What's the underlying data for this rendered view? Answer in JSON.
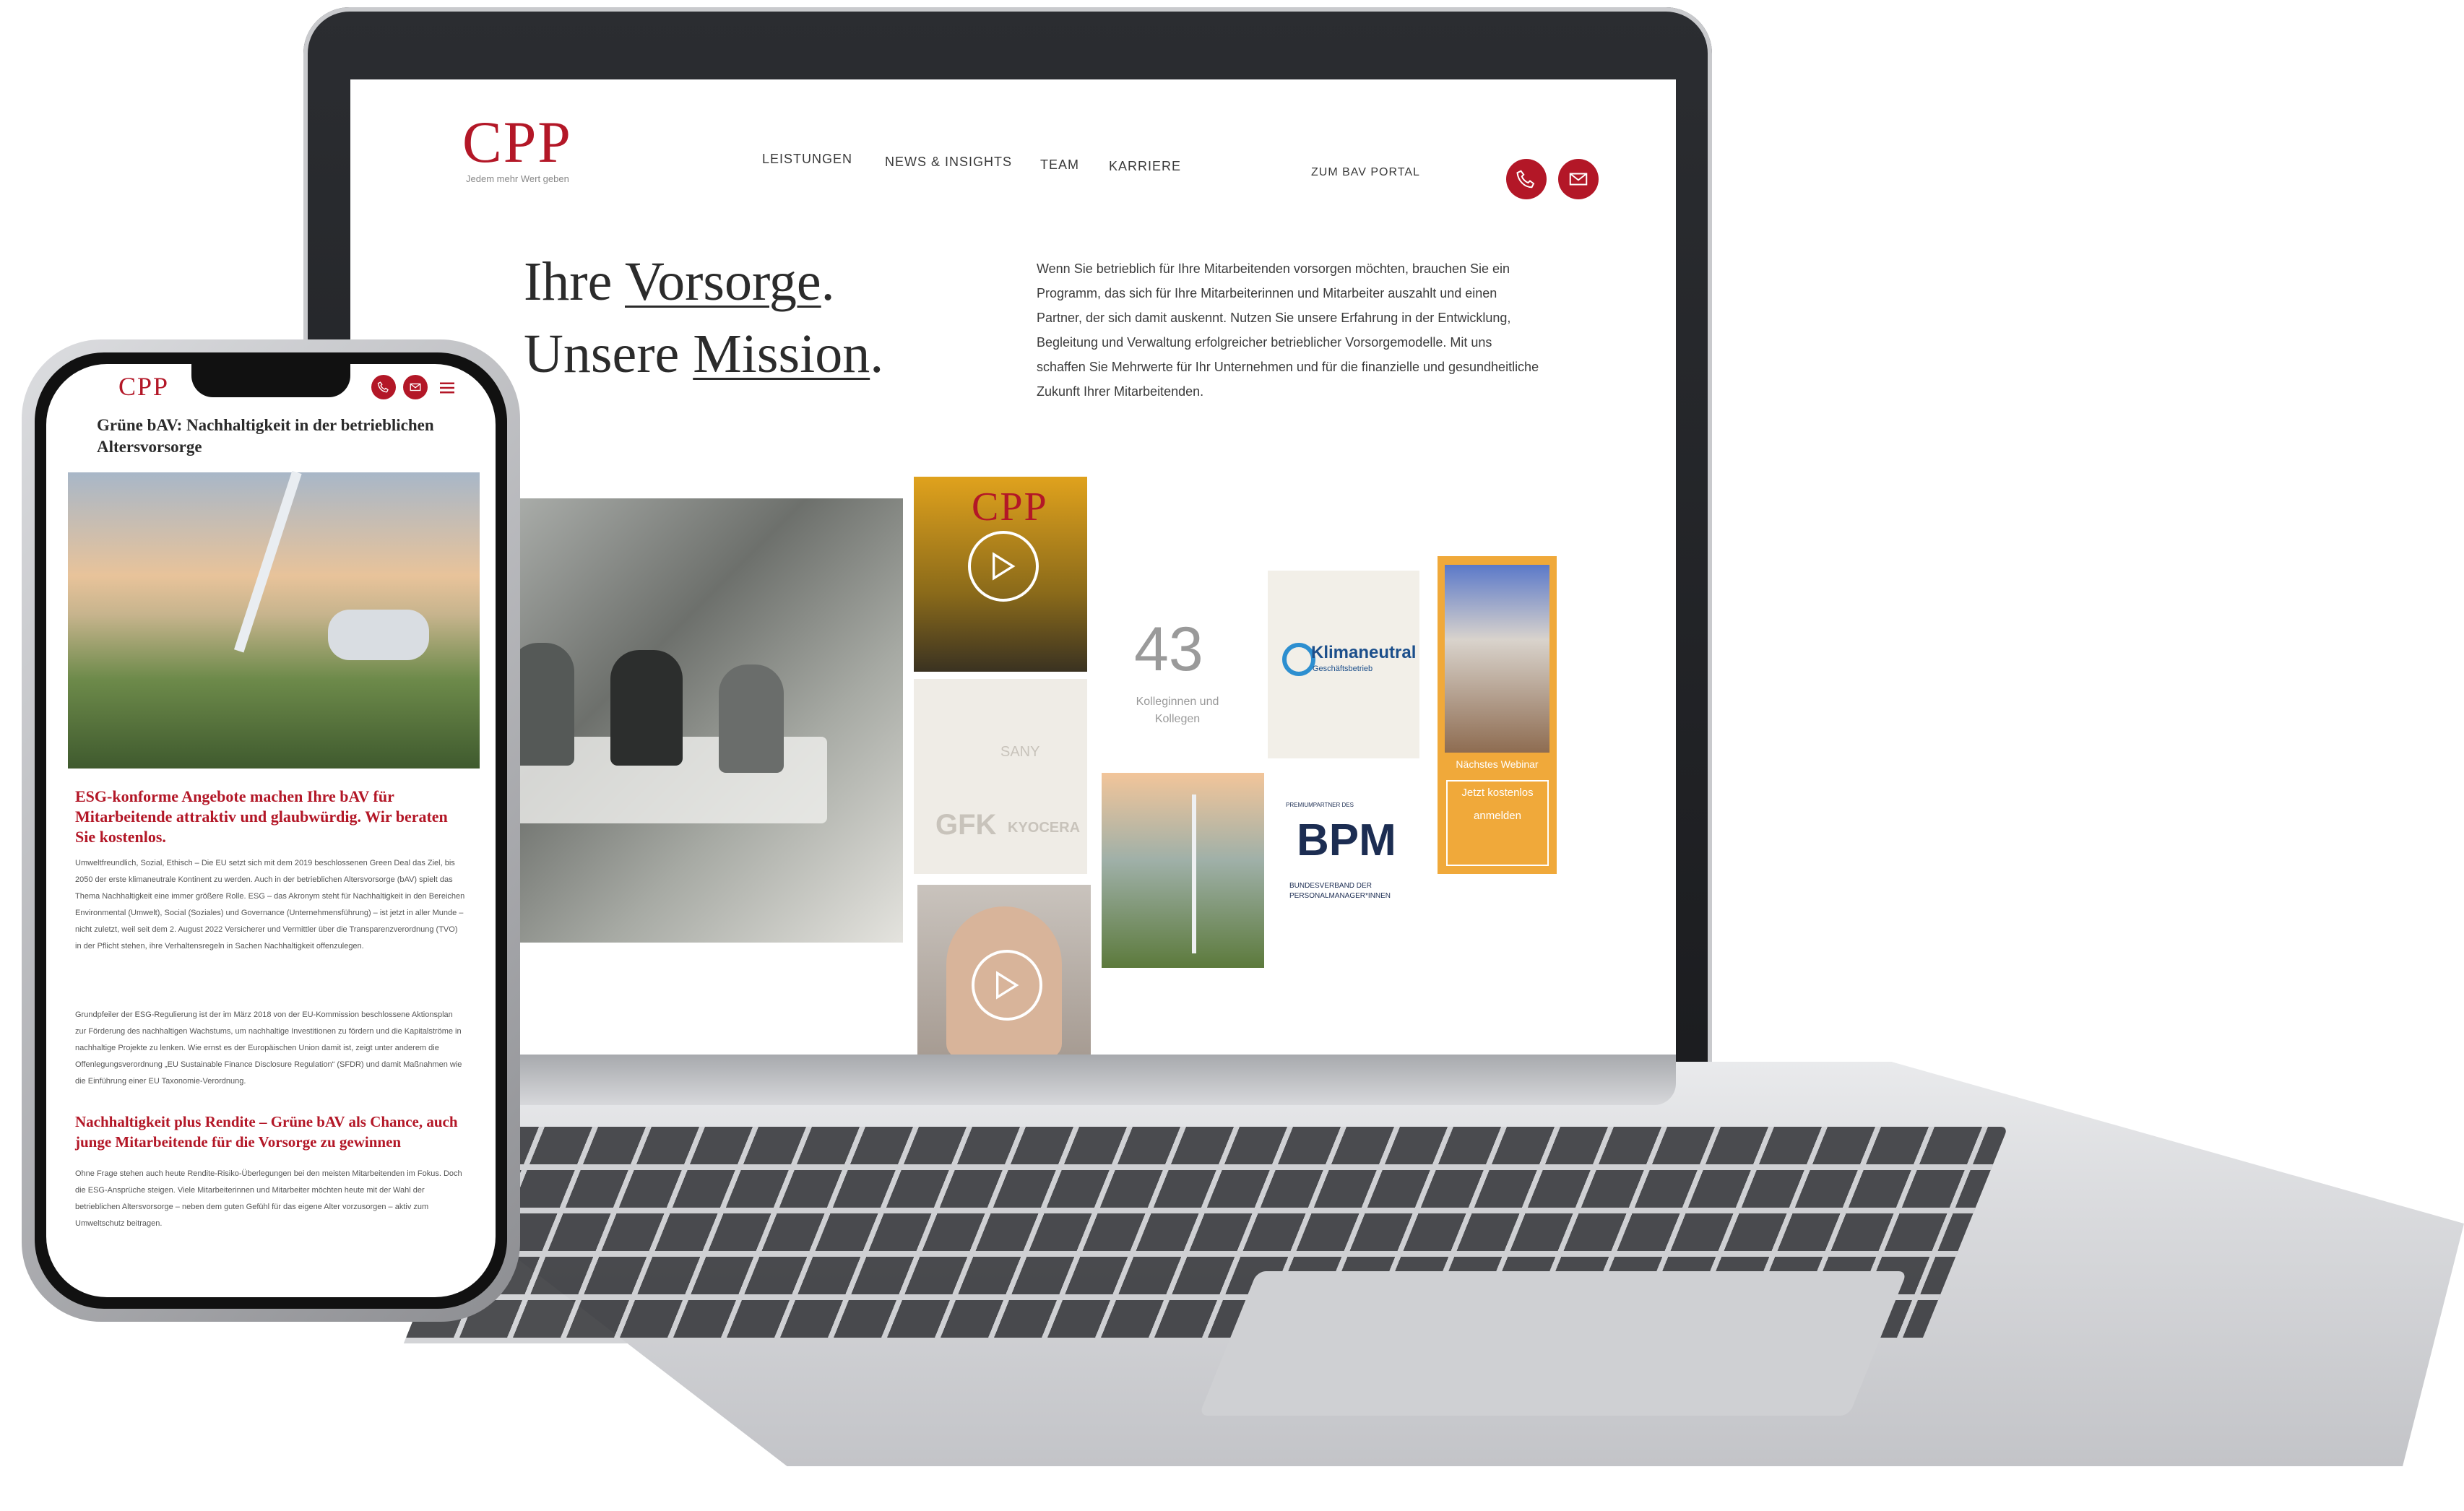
{
  "laptop_site": {
    "logo": "CPP",
    "tagline": "Jedem mehr Wert geben",
    "nav": [
      "LEISTUNGEN",
      "NEWS & INSIGHTS",
      "TEAM",
      "KARRIERE"
    ],
    "portal_link": "ZUM BAV PORTAL",
    "hero": {
      "line1_word1": "Ihre",
      "line1_word2": "Vorsorge",
      "line2_word1": "Unsere",
      "line2_word2": "Mission",
      "dot": "."
    },
    "intro_text": "Wenn Sie betrieblich für Ihre Mitarbeitenden vorsorgen möchten, brauchen Sie ein Programm, das sich für Ihre Mitarbeiterinnen und Mitarbeiter auszahlt und einen Partner, der sich damit auskennt. Nutzen Sie unsere Erfahrung in der Entwicklung, Begleitung und Verwaltung erfolgreicher betrieblicher Vorsorgemodelle. Mit uns schaffen Sie Mehrwerte für Ihr Unternehmen und für die finanzielle und gesundheitliche Zukunft Ihrer Mitarbeitenden.",
    "video_tile_logo": "CPP",
    "stat_number": "43",
    "stat_label": "Kolleginnen und Kollegen",
    "client_logos": [
      "SANY",
      "GFK",
      "KYOCERA"
    ],
    "klima_badge": {
      "title": "Klimaneutral",
      "subtitle": "Geschäftsbetrieb"
    },
    "bpm_badge": {
      "kicker": "PREMIUMPARTNER DES",
      "title": "BPM",
      "subtitle": "BUNDESVERBAND DER PERSONALMANAGER*INNEN"
    },
    "webinar": {
      "label": "Nächstes Webinar",
      "cta": "Jetzt kostenlos anmelden"
    }
  },
  "phone_site": {
    "logo": "CPP",
    "article_title": "Grüne bAV: Nachhaltigkeit in der betrieblichen Altersvorsorge",
    "headline1": "ESG-konforme Angebote machen Ihre bAV für Mitarbeitende attraktiv und glaubwürdig. Wir beraten Sie kostenlos.",
    "paragraph1": "Umweltfreundlich, Sozial, Ethisch – Die EU setzt sich mit dem 2019 beschlossenen Green Deal das Ziel, bis 2050 der erste klimaneutrale Kontinent zu werden. Auch in der betrieblichen Altersvorsorge (bAV) spielt das Thema Nachhaltigkeit eine immer größere Rolle. ESG – das Akronym steht für Nachhaltigkeit in den Bereichen Environmental (Umwelt), Social (Soziales) und Governance (Unternehmensführung) – ist jetzt in aller Munde – nicht zuletzt, weil seit dem 2. August 2022 Versicherer und Vermittler über die Transparenzverordnung (TVO) in der Pflicht stehen, ihre Verhaltensregeln in Sachen Nachhaltigkeit offenzulegen.",
    "paragraph2": "Grundpfeiler der ESG-Regulierung ist der im März 2018 von der EU-Kommission beschlossene Aktionsplan zur Förderung des nachhaltigen Wachstums, um nachhaltige Investitionen zu fördern und die Kapitalströme in nachhaltige Projekte zu lenken. Wie ernst es der Europäischen Union damit ist, zeigt unter anderem die Offenlegungsverordnung „EU Sustainable Finance Disclosure Regulation“ (SFDR) und damit Maßnahmen wie die Einführung einer EU Taxonomie-Verordnung.",
    "headline2": "Nachhaltigkeit plus Rendite – Grüne bAV als Chance, auch junge Mitarbeitende für die Vorsorge zu gewinnen",
    "paragraph3": "Ohne Frage stehen auch heute Rendite-Risiko-Überlegungen bei den meisten Mitarbeitenden im Fokus. Doch die ESG-Ansprüche steigen. Viele Mitarbeiterinnen und Mitarbeiter möchten heute mit der Wahl der betrieblichen Altersvorsorge – neben dem guten Gefühl für das eigene Alter vorzusorgen – aktiv zum Umweltschutz beitragen."
  },
  "colors": {
    "brand_red": "#b31727",
    "webinar_orange": "#f0a93a"
  },
  "icons": [
    "phone-icon",
    "mail-icon",
    "menu-icon",
    "play-icon"
  ]
}
